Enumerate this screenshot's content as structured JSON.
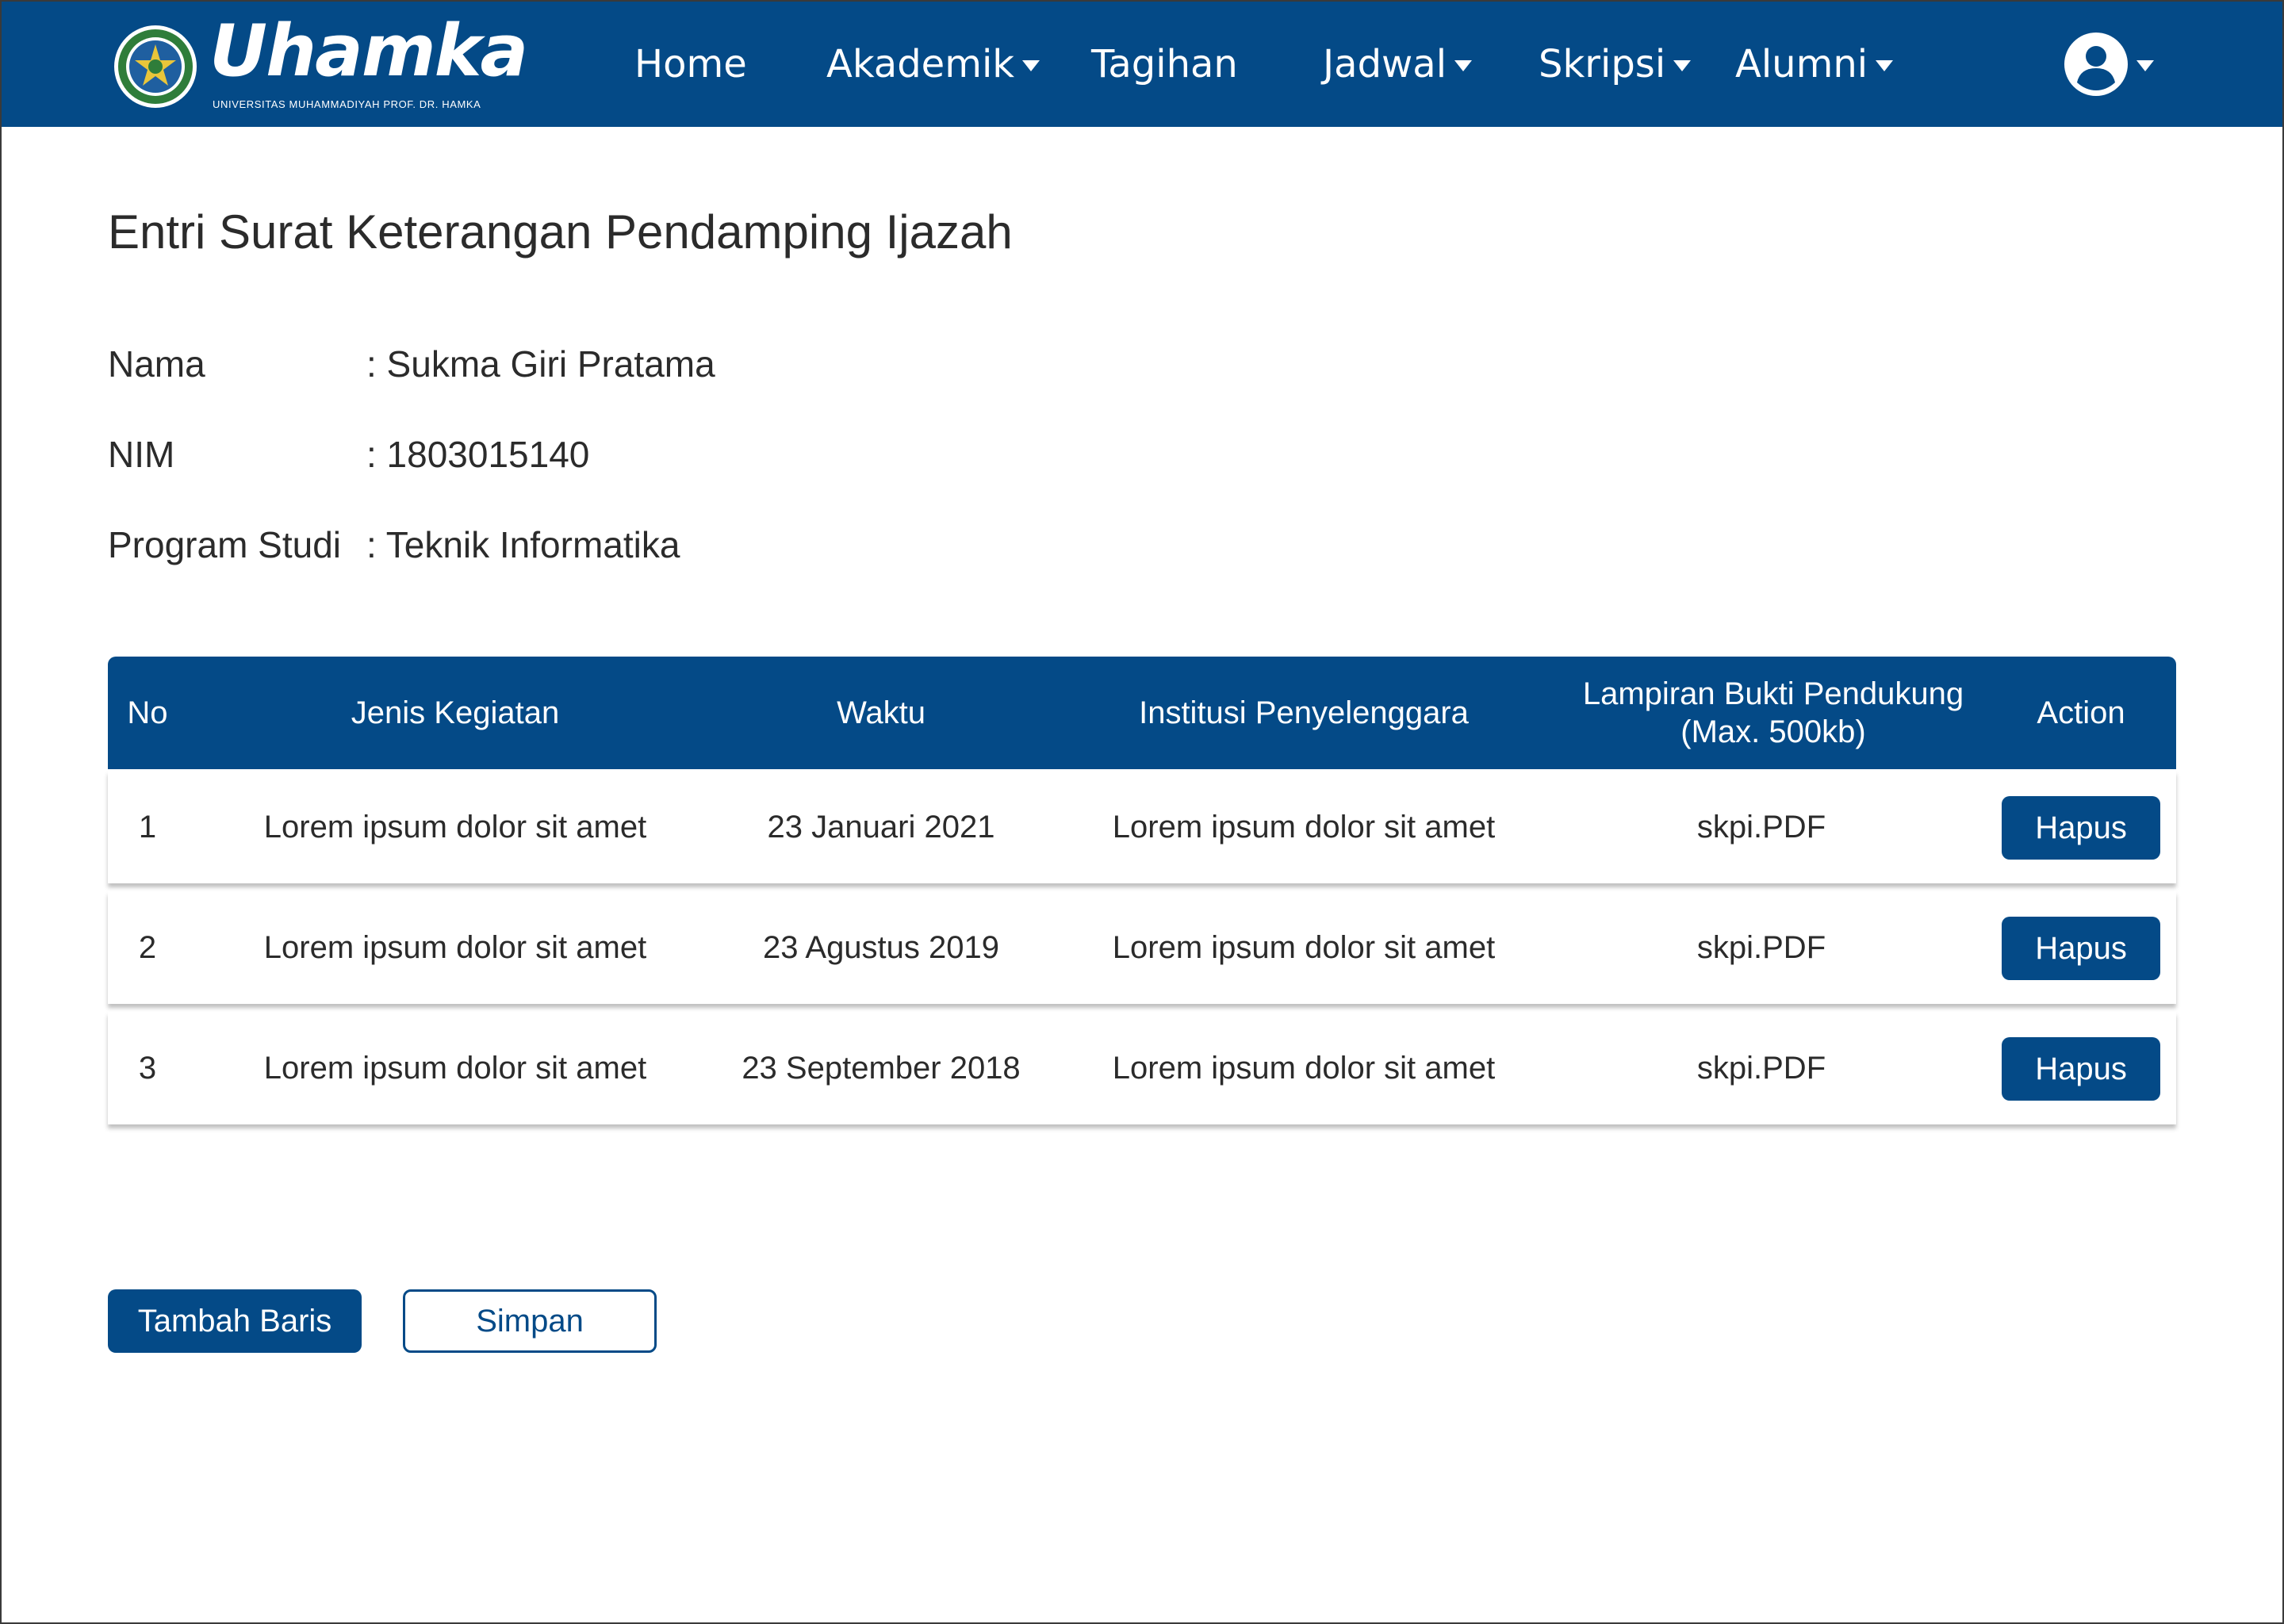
{
  "brand": {
    "name": "Uhamka",
    "subtitle": "UNIVERSITAS MUHAMMADIYAH PROF. DR. HAMKA",
    "primary_color": "#044a87"
  },
  "nav": {
    "items": [
      {
        "label": "Home",
        "dropdown": false
      },
      {
        "label": "Akademik",
        "dropdown": true
      },
      {
        "label": "Tagihan",
        "dropdown": false
      },
      {
        "label": "Jadwal",
        "dropdown": true
      },
      {
        "label": "Skripsi",
        "dropdown": true
      },
      {
        "label": "Alumni",
        "dropdown": true
      }
    ],
    "user_icon": "user-circle-icon"
  },
  "page": {
    "title": "Entri Surat Keterangan Pendamping Ijazah"
  },
  "student": {
    "name_label": "Nama",
    "name_value": ":  Sukma Giri Pratama",
    "nim_label": "NIM",
    "nim_value": ": 1803015140",
    "program_label": "Program Studi",
    "program_value": ": Teknik Informatika"
  },
  "table": {
    "headers": {
      "no": "No",
      "jenis": "Jenis Kegiatan",
      "waktu": "Waktu",
      "institusi": "Institusi Penyelenggara",
      "lampiran_line1": "Lampiran Bukti Pendukung",
      "lampiran_line2": "(Max. 500kb)",
      "action": "Action"
    },
    "rows": [
      {
        "no": "1",
        "jenis": "Lorem ipsum dolor sit amet",
        "waktu": "23 Januari 2021",
        "institusi": "Lorem ipsum dolor sit amet",
        "lampiran": "skpi.PDF",
        "action": "Hapus"
      },
      {
        "no": "2",
        "jenis": "Lorem ipsum dolor sit amet",
        "waktu": "23 Agustus 2019",
        "institusi": "Lorem ipsum dolor sit amet",
        "lampiran": "skpi.PDF",
        "action": "Hapus"
      },
      {
        "no": "3",
        "jenis": "Lorem ipsum dolor sit amet",
        "waktu": "23 September 2018",
        "institusi": "Lorem ipsum dolor sit amet",
        "lampiran": "skpi.PDF",
        "action": "Hapus"
      }
    ]
  },
  "actions": {
    "add_row": "Tambah Baris",
    "save": "Simpan"
  }
}
